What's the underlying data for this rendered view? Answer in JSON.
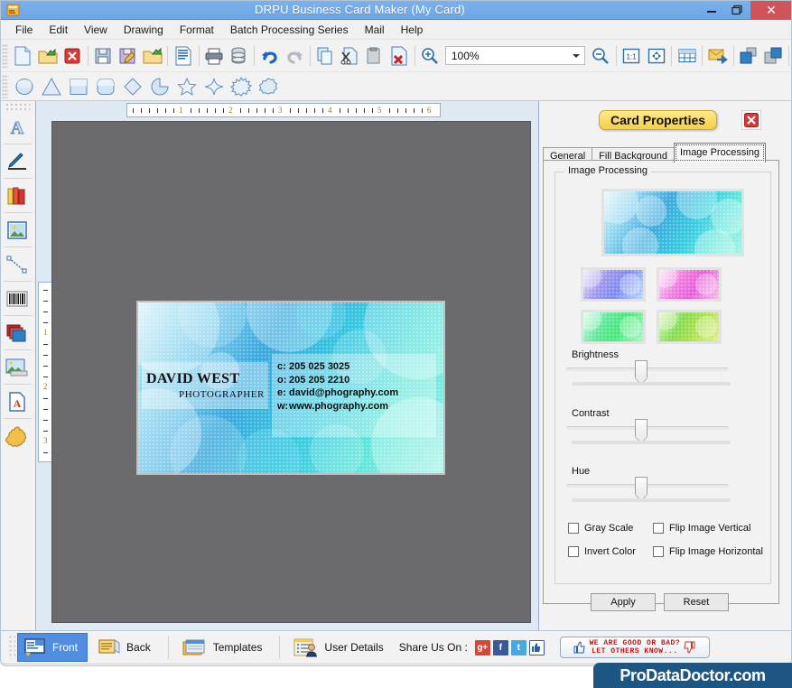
{
  "window": {
    "title": "DRPU Business Card Maker (My Card)",
    "icon": "app-icon",
    "minimize": "–",
    "maximize": "❐",
    "close": "✕"
  },
  "menubar": {
    "items": [
      {
        "label": "File"
      },
      {
        "label": "Edit"
      },
      {
        "label": "View"
      },
      {
        "label": "Drawing"
      },
      {
        "label": "Format"
      },
      {
        "label": "Batch Processing Series"
      },
      {
        "label": "Mail"
      },
      {
        "label": "Help"
      }
    ]
  },
  "toolbar": {
    "zoom_value": "100%",
    "buttons": [
      {
        "name": "new-document-icon"
      },
      {
        "name": "open-folder-icon"
      },
      {
        "name": "close-document-icon"
      },
      {
        "name": "save-icon"
      },
      {
        "name": "save-as-icon"
      },
      {
        "name": "open-project-icon"
      },
      {
        "name": "properties-icon"
      },
      {
        "name": "print-icon"
      },
      {
        "name": "database-icon"
      },
      {
        "name": "undo-icon"
      },
      {
        "name": "redo-icon"
      },
      {
        "name": "copy-icon"
      },
      {
        "name": "cut-icon"
      },
      {
        "name": "paste-icon"
      },
      {
        "name": "delete-icon"
      },
      {
        "name": "zoom-in-icon"
      },
      {
        "name": "zoom-out-icon"
      },
      {
        "name": "actual-size-icon"
      },
      {
        "name": "fit-page-icon"
      },
      {
        "name": "grid-icon"
      },
      {
        "name": "mail-icon"
      },
      {
        "name": "send-back-icon"
      },
      {
        "name": "bring-front-icon"
      }
    ]
  },
  "shapes_toolbar": {
    "shapes": [
      {
        "name": "ellipse-shape-icon"
      },
      {
        "name": "triangle-shape-icon"
      },
      {
        "name": "rectangle-shape-icon"
      },
      {
        "name": "rounded-rectangle-shape-icon"
      },
      {
        "name": "diamond-shape-icon"
      },
      {
        "name": "pie-shape-icon"
      },
      {
        "name": "star5-shape-icon"
      },
      {
        "name": "star4-shape-icon"
      },
      {
        "name": "burst-shape-icon"
      },
      {
        "name": "polygon-shape-icon"
      }
    ]
  },
  "left_tools": [
    {
      "name": "text-tool",
      "glyph": "A"
    },
    {
      "name": "signature-tool",
      "glyph": "✒"
    },
    {
      "name": "barcode-books-tool",
      "glyph": "▮▮"
    },
    {
      "name": "image-tool",
      "glyph": "🖼"
    },
    {
      "name": "line-tool",
      "glyph": "╲"
    },
    {
      "name": "barcode-tool",
      "glyph": "|||"
    },
    {
      "name": "layers-tool",
      "glyph": "▤"
    },
    {
      "name": "picture-tool",
      "glyph": "🏞"
    },
    {
      "name": "watermark-text-tool",
      "glyph": "A"
    },
    {
      "name": "clipart-tool",
      "glyph": "✿"
    }
  ],
  "rulers": {
    "horizontal_labels": [
      "1",
      "2",
      "3",
      "4",
      "5",
      "6"
    ],
    "vertical_labels": [
      "1",
      "2",
      "3"
    ]
  },
  "card": {
    "name": "DAVID WEST",
    "role": "PHOTOGRAPHER",
    "contact_lines": [
      {
        "key": "c:",
        "value": "205 025 3025"
      },
      {
        "key": "o:",
        "value": "205 205 2210"
      },
      {
        "key": "e:",
        "value": "david@phography.com"
      },
      {
        "key": "w:",
        "value": "www.phography.com"
      }
    ]
  },
  "properties_panel": {
    "title": "Card Properties",
    "close_label": "✕",
    "tabs": [
      {
        "label": "General",
        "active": false
      },
      {
        "label": "Fill Background",
        "active": false
      },
      {
        "label": "Image Processing",
        "active": true
      }
    ],
    "group_label": "Image Processing",
    "thumbnails": [
      {
        "name": "preview-main"
      },
      {
        "name": "preview-purple"
      },
      {
        "name": "preview-magenta"
      },
      {
        "name": "preview-green"
      },
      {
        "name": "preview-yellow-green"
      }
    ],
    "sliders": [
      {
        "label": "Brightness",
        "value": 50
      },
      {
        "label": "Contrast",
        "value": 50
      },
      {
        "label": "Hue",
        "value": 50
      }
    ],
    "checkboxes": [
      {
        "label": "Gray Scale",
        "checked": false
      },
      {
        "label": "Flip Image Vertical",
        "checked": false
      },
      {
        "label": "Invert Color",
        "checked": false
      },
      {
        "label": "Flip Image Horizontal",
        "checked": false
      }
    ],
    "apply_label": "Apply",
    "reset_label": "Reset"
  },
  "bottombar": {
    "front_label": "Front",
    "back_label": "Back",
    "templates_label": "Templates",
    "user_details_label": "User Details",
    "share_label": "Share Us On :",
    "social": [
      {
        "name": "google-plus-icon",
        "glyph": "g+",
        "color": "#d34836"
      },
      {
        "name": "facebook-icon",
        "glyph": "f",
        "color": "#3b5998"
      },
      {
        "name": "twitter-icon",
        "glyph": "t",
        "color": "#4aa8e0"
      },
      {
        "name": "like-icon",
        "glyph": "👍",
        "color": "#ffffff"
      }
    ],
    "feedback_line1": "WE ARE GOOD OR BAD?",
    "feedback_line2": "LET OTHERS KNOW..."
  },
  "brand": {
    "text": "ProDataDoctor.com"
  },
  "colors": {
    "titlebar": "#74abe9",
    "close_button": "#cf5359",
    "accent_yellow": "#f2cf4e",
    "canvas_bg": "#6b6b6e",
    "panel_bg": "#f2f2f2",
    "active_tab_bg": "#4f8ee0",
    "brand_bg": "#1d5583"
  }
}
